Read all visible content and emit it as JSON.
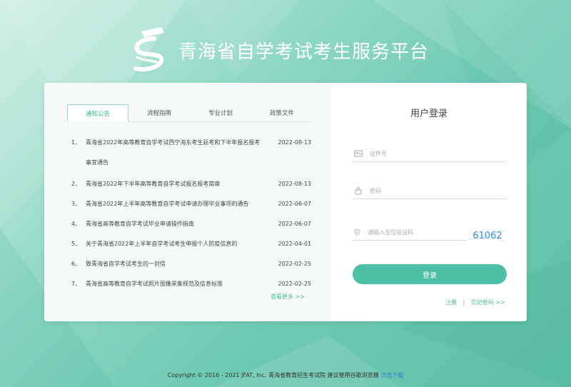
{
  "header": {
    "title": "青海省自学考试考生服务平台"
  },
  "tabs": [
    {
      "label": "通知公告",
      "active": true
    },
    {
      "label": "流程指南",
      "active": false
    },
    {
      "label": "专业计划",
      "active": false
    },
    {
      "label": "政策文件",
      "active": false
    }
  ],
  "news": [
    {
      "num": "1、",
      "title": "青海省2022年高等教育自学考试西宁海东考生延考和下半年报名报考事宜通告",
      "date": "2022-08-13"
    },
    {
      "num": "2、",
      "title": "青海省2022年下半年高等教育自学考试报名报考简章",
      "date": "2022-08-13"
    },
    {
      "num": "3、",
      "title": "青海省2022年上半年高等教育自学考试申请办理毕业事项的通告",
      "date": "2022-06-07"
    },
    {
      "num": "4、",
      "title": "青海省高等教育自学考试毕业申请操作指南",
      "date": "2022-06-07"
    },
    {
      "num": "5、",
      "title": "关于青海省2022年上半年自学考试考生申报个人防疫信息的",
      "date": "2022-04-01"
    },
    {
      "num": "6、",
      "title": "致青海省自学考试考生的一封信",
      "date": "2022-02-25"
    },
    {
      "num": "7、",
      "title": "青海省高等教育自学考试照片图像采集规范及信息标准",
      "date": "2022-02-25"
    }
  ],
  "more_label": "查看更多 >>",
  "login": {
    "title": "用户登录",
    "id_placeholder": "证件号",
    "password_placeholder": "密码",
    "captcha_placeholder": "请输入五位验证码",
    "captcha_text": "61062",
    "submit_label": "登录",
    "register_label": "注册",
    "separator": "|",
    "forgot_label": "忘记密码 >>"
  },
  "footer": {
    "copyright": "Copyright © 2016 - 2021 JFAT, Inc. 青海省教育招生考试院 建议使用谷歌浏览器",
    "download_label": "点击下载"
  },
  "colors": {
    "accent": "#4cbfa5",
    "link": "#47b89c",
    "download": "#2f7fd6"
  }
}
